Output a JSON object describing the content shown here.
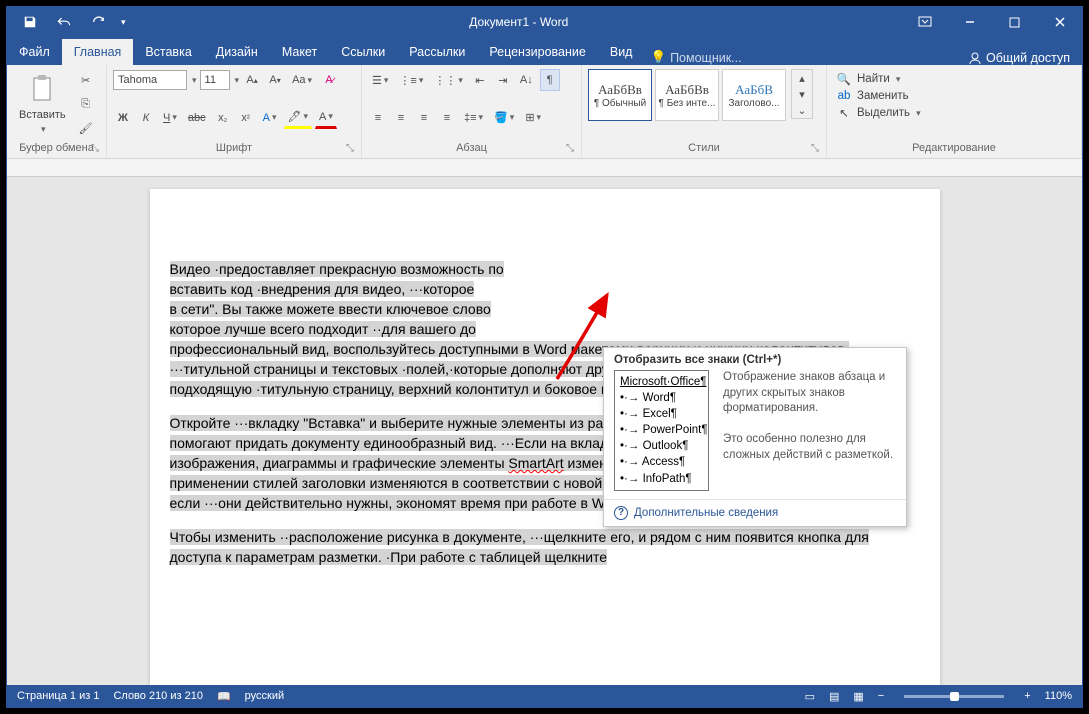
{
  "titlebar": {
    "title": "Документ1 - Word"
  },
  "tabs": {
    "file": "Файл",
    "home": "Главная",
    "insert": "Вставка",
    "design": "Дизайн",
    "layout": "Макет",
    "references": "Ссылки",
    "mailings": "Рассылки",
    "review": "Рецензирование",
    "view": "Вид",
    "tell": "Помощник...",
    "signin": "",
    "share": "Общий доступ"
  },
  "ribbon": {
    "clipboard": {
      "paste": "Вставить",
      "label": "Буфер обмена"
    },
    "font": {
      "name": "Tahoma",
      "size": "11",
      "label": "Шрифт"
    },
    "paragraph": {
      "label": "Абзац"
    },
    "styles": {
      "label": "Стили",
      "preview": "АаБбВв",
      "s1": "¶ Обычный",
      "s2": "¶ Без инте...",
      "s3": "Заголово...",
      "s3prev": "АаБбВ"
    },
    "editing": {
      "label": "Редактирование",
      "find": "Найти",
      "replace": "Заменить",
      "select": "Выделить"
    }
  },
  "tooltip": {
    "heading": "Отобразить все знаки (Ctrl+*)",
    "list_title": "Microsoft·Office¶",
    "items": [
      "Word¶",
      "Excel¶",
      "PowerPoint¶",
      "Outlook¶",
      "Access¶",
      "InfoPath¶"
    ],
    "desc1": "Отображение знаков абзаца и других скрытых знаков форматирования.",
    "desc2": "Это особенно полезно для сложных действий с разметкой.",
    "more": "Дополнительные сведения"
  },
  "document": {
    "p1a": "Видео ·предоставляет прекрасную возможность по",
    "p1b": "вставить код ·внедрения для видео, ···которое",
    "p1c": "в сети\". Вы также можете ввести ключевое слово",
    "p1d": "которое лучше всего подходит ··для вашего до",
    "p1e": "профессиональный вид, воспользуйтесь доступными в Word макетами верхних и нижних колонтитулов, ···титульной страницы и текстовых ·полей,·которые дополняют друг друга. Например, ··вы можете добавить подходящую ·титульную страницу, верхний колонтитул и боковое примечание.",
    "p2a": "Откройте ···вкладку \"Вставка\" и выберите нужные элементы из различных коллекций. ··Темы и стили также помогают придать документу единообразный вид. ···Если на вкладке \"Конструктор\" ···выбрать другую тему, то изображения, диаграммы и графические элементы ",
    "p2b": " изменятся соответствующим образом. При применении стилей заголовки изменяются в соответствии с новой темой. Новые кнопки, которые видны, только если ···они действительно нужны, экономят время при работе в Word.",
    "smartart": "SmartArt",
    "p3": "Чтобы изменить ··расположение рисунка в документе, ···щелкните его, и рядом с ним появится кнопка для доступа к параметрам разметки. ·При работе с таблицей щелкните"
  },
  "statusbar": {
    "page": "Страница 1 из 1",
    "words": "Слово 210 из 210",
    "lang": "русский",
    "zoom": "110%"
  }
}
